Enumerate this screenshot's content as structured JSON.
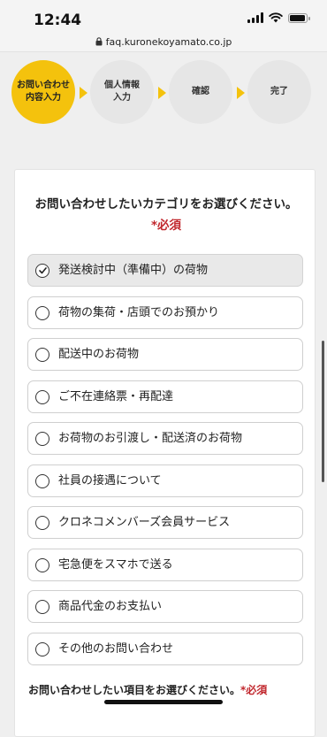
{
  "status_bar": {
    "time": "12:44"
  },
  "browser": {
    "url": "faq.kuronekoyamato.co.jp"
  },
  "steps": [
    {
      "label": "お問い合わせ\n内容入力",
      "active": true
    },
    {
      "label": "個人情報\n入力",
      "active": false
    },
    {
      "label": "確認",
      "active": false
    },
    {
      "label": "完了",
      "active": false
    }
  ],
  "form": {
    "question": "お問い合わせしたいカテゴリをお選びください。",
    "required_mark": "*必須",
    "options": [
      "発送検討中（準備中）の荷物",
      "荷物の集荷・店頭でのお預かり",
      "配送中のお荷物",
      "ご不在連絡票・再配達",
      "お荷物のお引渡し・配送済のお荷物",
      "社員の接遇について",
      "クロネコメンバーズ会員サービス",
      "宅急便をスマホで送る",
      "商品代金のお支払い",
      "その他のお問い合わせ"
    ],
    "selected_index": 0,
    "next_question": "お問い合わせしたい項目をお選びください。",
    "next_required_mark": "*必須"
  },
  "colors": {
    "accent_yellow": "#f4c20d",
    "required_red": "#c1272d",
    "step_inactive": "#e6e6e6"
  }
}
